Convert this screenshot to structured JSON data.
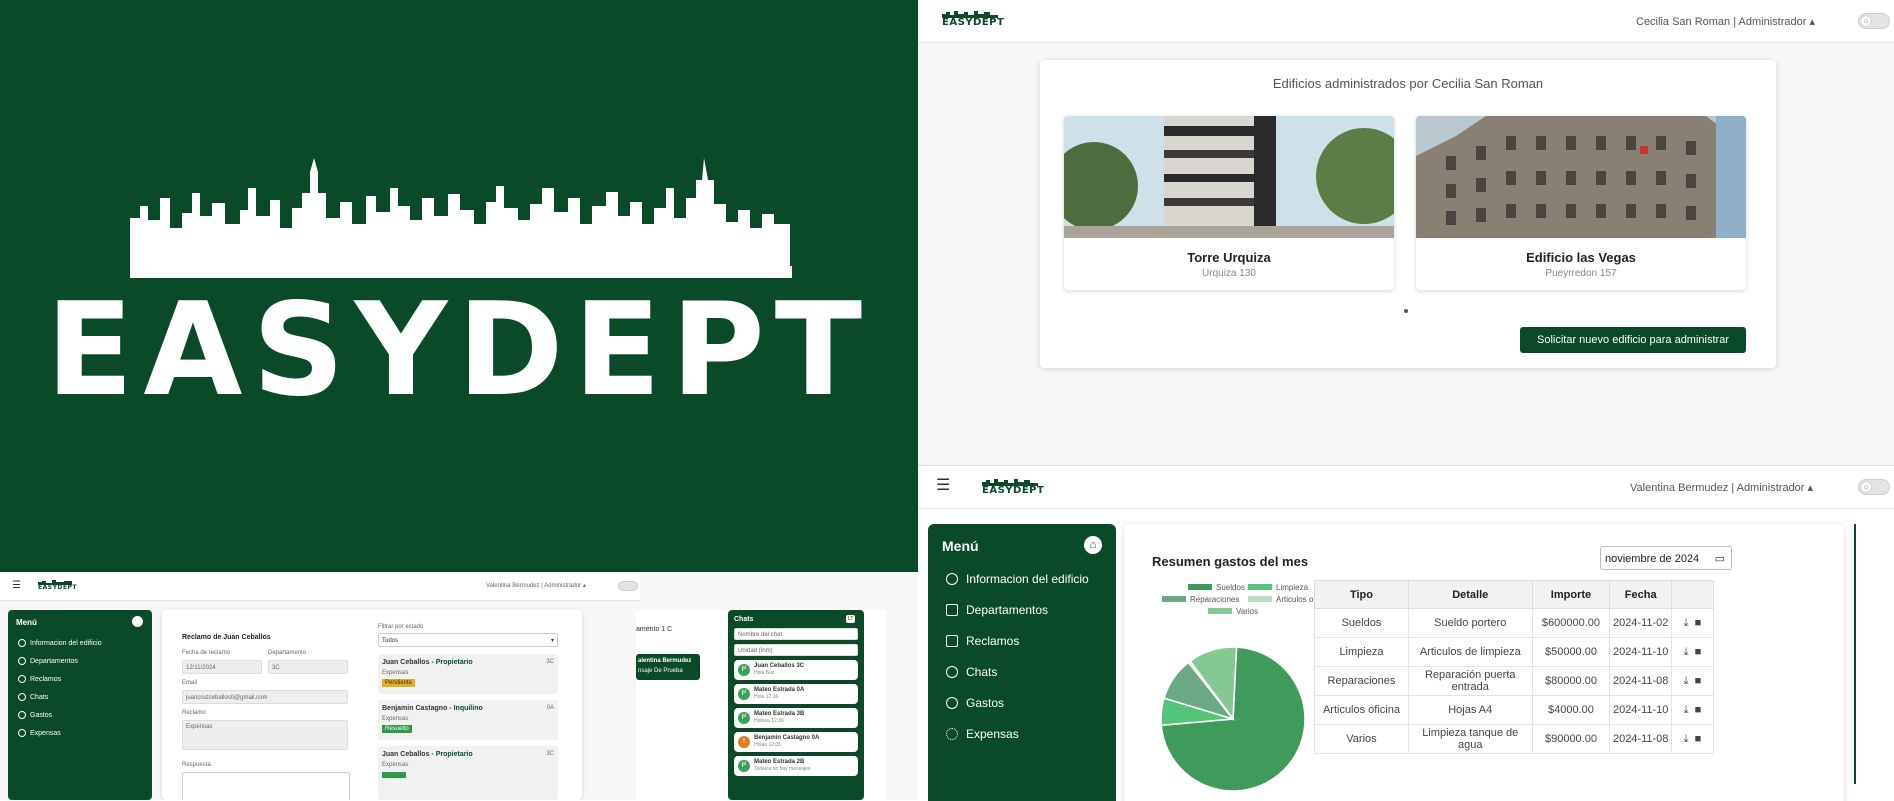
{
  "brand": {
    "name": "EASYDEPT",
    "green": "#0a4a29"
  },
  "top_right": {
    "user": "Cecilia San Roman | Administrador",
    "title": "Edificios administrados por Cecilia San Roman",
    "buildings": [
      {
        "name": "Torre Urquiza",
        "address": "Urquiza 130"
      },
      {
        "name": "Edificio las Vegas",
        "address": "Pueyrredon 157"
      }
    ],
    "request_button": "Solicitar nuevo edificio para administrar"
  },
  "bottom_right": {
    "user": "Valentina Bermudez | Administrador",
    "menu_title": "Menú",
    "menu_items": [
      {
        "label": "Informacion del edificio",
        "icon": "info-icon"
      },
      {
        "label": "Departamentos",
        "icon": "grid-icon"
      },
      {
        "label": "Reclamos",
        "icon": "megaphone-icon"
      },
      {
        "label": "Chats",
        "icon": "chat-icon"
      },
      {
        "label": "Gastos",
        "icon": "money-icon"
      },
      {
        "label": "Expensas",
        "icon": "percent-icon"
      }
    ],
    "summary_title": "Resumen gastos del mes",
    "month_value": "noviembre de 2024",
    "legend": [
      "Sueldos",
      "Limpieza",
      "Reparaciones",
      "Articulos oficina",
      "Varios"
    ],
    "table_headers": [
      "Tipo",
      "Detalle",
      "Importe",
      "Fecha"
    ],
    "rows": [
      {
        "tipo": "Sueldos",
        "detalle": "Sueldo portero",
        "importe": "$600000.00",
        "fecha": "2024-11-02"
      },
      {
        "tipo": "Limpieza",
        "detalle": "Articulos de limpieza",
        "importe": "$50000.00",
        "fecha": "2024-11-10"
      },
      {
        "tipo": "Reparaciones",
        "detalle": "Reparación puerta entrada",
        "importe": "$80000.00",
        "fecha": "2024-11-08"
      },
      {
        "tipo": "Articulos oficina",
        "detalle": "Hojas A4",
        "importe": "$4000.00",
        "fecha": "2024-11-10"
      },
      {
        "tipo": "Varios",
        "detalle": "Limpieza tanque de agua",
        "importe": "$90000.00",
        "fecha": "2024-11-08"
      }
    ]
  },
  "chart_data": {
    "type": "pie",
    "categories": [
      "Sueldos",
      "Limpieza",
      "Reparaciones",
      "Articulos oficina",
      "Varios"
    ],
    "values": [
      600000,
      50000,
      80000,
      4000,
      90000
    ],
    "colors": [
      "#3f9a5c",
      "#53c47a",
      "#6aa983",
      "#b9dcc3",
      "#86c894"
    ],
    "title": "",
    "legend_position": "top"
  },
  "bottom_left": {
    "user": "Valentina Bermudez | Administrador",
    "menu_title": "Menú",
    "menu_items": [
      "Informacion del edificio",
      "Departamentos",
      "Reclamos",
      "Chats",
      "Gastos",
      "Expensas"
    ],
    "claim_title": "Reclamo de Juan Ceballos",
    "labels": {
      "fecha": "Fecha de reclamo",
      "depto": "Departamento",
      "email": "Email",
      "reclamo": "Reclamo",
      "respuesta": "Respuesta",
      "filtro": "Filtrar por estado"
    },
    "values": {
      "fecha": "12/11/2024",
      "depto": "3C",
      "email": "juancruzceballos0@gmail.com",
      "reclamo": "Expensas",
      "filtro": "Todos"
    },
    "claims": [
      {
        "name": "Juan Ceballos",
        "role": "Propietario",
        "unit": "3C",
        "type": "Expensas",
        "status": "Pendiente",
        "status_color": "#e0b020"
      },
      {
        "name": "Benjamin Castagno",
        "role": "Inquilino",
        "unit": "0A",
        "type": "Expensas",
        "status": "Resuelto",
        "status_color": "#2e9a4a"
      },
      {
        "name": "Juan Ceballos",
        "role": "Propietario",
        "unit": "3C",
        "type": "Expensas",
        "status": "",
        "status_color": "#2e9a4a"
      }
    ],
    "chat_fragment": {
      "unit": "amento 1 C",
      "name": "alentina Bermudez",
      "msg": "nsaje De Prueba"
    },
    "chats_title": "Chats",
    "chats_badge": "LT",
    "chat_inputs": [
      "Nombre del chat",
      "Unidad (Inm)"
    ],
    "chats": [
      {
        "initial": "P",
        "name": "Juan Ceballos 3C",
        "sub": "Hola Buz",
        "color": "#3aa35a"
      },
      {
        "initial": "P",
        "name": "Mateo Estrada 0A",
        "sub": "Hola 12:36",
        "color": "#3aa35a"
      },
      {
        "initial": "P",
        "name": "Mateo Estrada 3B",
        "sub": "Holaaa 12:36",
        "color": "#3aa35a"
      },
      {
        "initial": "I",
        "name": "Benjamin Castagno 0A",
        "sub": "Holaa 12:05",
        "color": "#e07b1e"
      },
      {
        "initial": "P",
        "name": "Mateo Estrada 2B",
        "sub": "Todavia no hay mensajes",
        "color": "#3aa35a"
      }
    ]
  }
}
